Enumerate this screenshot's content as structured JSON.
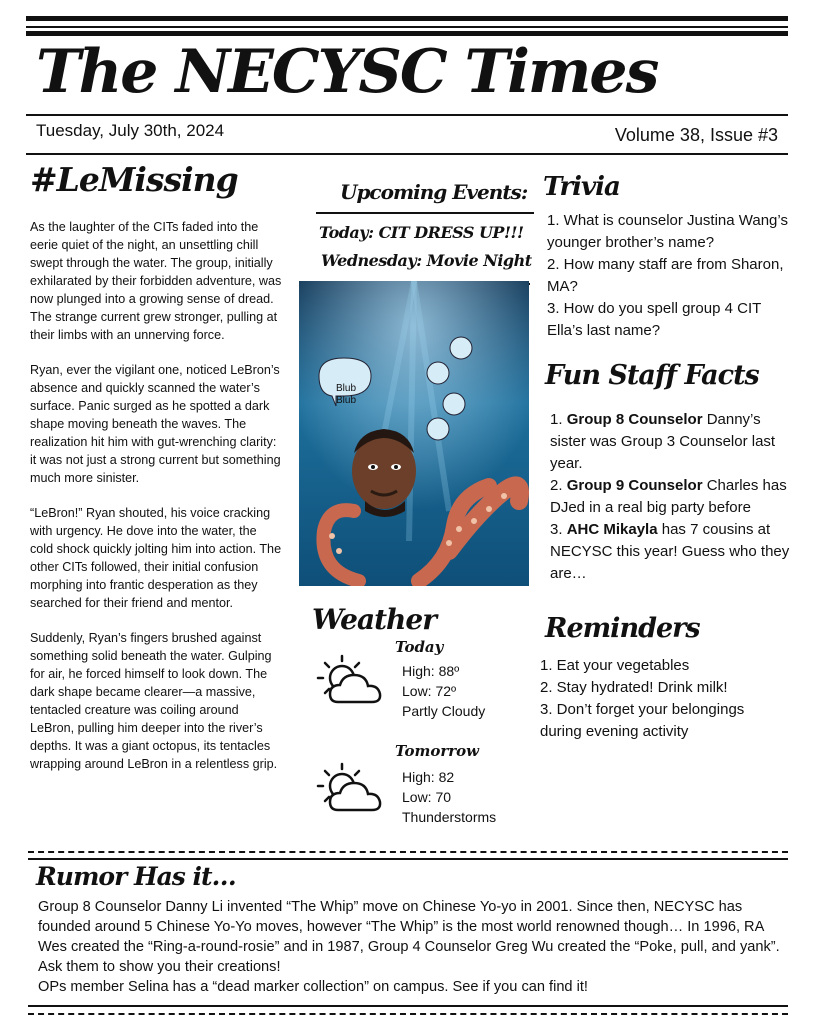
{
  "masthead": {
    "title": "The NECYSC Times",
    "date": "Tuesday, July 30th, 2024",
    "volume": "Volume 38, Issue #3"
  },
  "story": {
    "headline": "#LeMissing",
    "paragraphs": [
      "As the laughter of the CITs faded into the eerie quiet of the night, an unsettling chill swept through the water. The group, initially exhilarated by their forbidden adventure, was now plunged into a growing sense of dread. The strange current grew stronger, pulling at their limbs with an unnerving force.",
      "Ryan, ever the vigilant one, noticed LeBron’s absence and quickly scanned the water’s surface. Panic surged as he spotted a dark shape moving beneath the waves. The realization hit him with gut-wrenching clarity: it was not just a strong current but something much more sinister.",
      "“LeBron!” Ryan shouted, his voice cracking with urgency. He dove into the water, the cold shock quickly jolting him into action. The other CITs followed, their initial confusion morphing into frantic desperation as they searched for their friend and mentor.",
      "Suddenly, Ryan’s fingers brushed against something solid beneath the water. Gulping for air, he forced himself to look down. The dark shape became clearer—a massive, tentacled creature was coiling around LeBron, pulling him deeper into the river’s depths. It was a giant octopus, its tentacles wrapping around LeBron in a relentless grip."
    ]
  },
  "events": {
    "title": "Upcoming Events:",
    "today": "Today: CIT DRESS UP!!!",
    "wednesday": "Wednesday: Movie Night"
  },
  "photo": {
    "bubble_text": "Blub Blub",
    "water_color": "#1d6f9c",
    "octopus_color": "#c8684f"
  },
  "weather": {
    "title": "Weather",
    "today": {
      "label": "Today",
      "high": "High: 88º",
      "low": "Low: 72º",
      "cond": "Partly Cloudy",
      "icon": "partly-cloudy-icon"
    },
    "tomorrow": {
      "label": "Tomorrow",
      "high": "High: 82",
      "low": "Low: 70",
      "cond": "Thunderstorms",
      "icon": "partly-cloudy-icon"
    }
  },
  "trivia": {
    "title": "Trivia",
    "items": [
      "1. What is counselor Justina Wang’s younger brother’s name?",
      "2. How many staff are from Sharon, MA?",
      "3. How do you spell group 4 CIT Ella’s last name?"
    ]
  },
  "facts": {
    "title": "Fun Staff Facts",
    "items": [
      {
        "num": "1. ",
        "bold": "Group 8 Counselor",
        "rest": " Danny’s sister was Group 3 Counselor last year."
      },
      {
        "num": "2. ",
        "bold": "Group 9 Counselor",
        "rest": " Charles has DJed in a real big party before"
      },
      {
        "num": "3. ",
        "bold": "AHC Mikayla",
        "rest": " has 7 cousins at NECYSC this year! Guess who they are…"
      }
    ]
  },
  "reminders": {
    "title": "Reminders",
    "items": [
      "1. Eat your vegetables",
      "2. Stay hydrated! Drink milk!",
      "3. Don’t forget your belongings during evening activity"
    ]
  },
  "rumor": {
    "title": "Rumor Has it…",
    "lines": [
      "Group 8 Counselor Danny Li invented “The Whip” move on Chinese Yo-yo in 2001. Since then, NECYSC has founded around 5 Chinese Yo-Yo moves, however “The Whip” is the most world renowned though… In 1996, RA Wes created the “Ring-a-round-rosie” and in 1987, Group 4 Counselor Greg Wu created the “Poke, pull, and yank”. Ask them to show you their creations!",
      "OPs member Selina has a “dead marker collection” on campus. See if you can find it!"
    ]
  }
}
